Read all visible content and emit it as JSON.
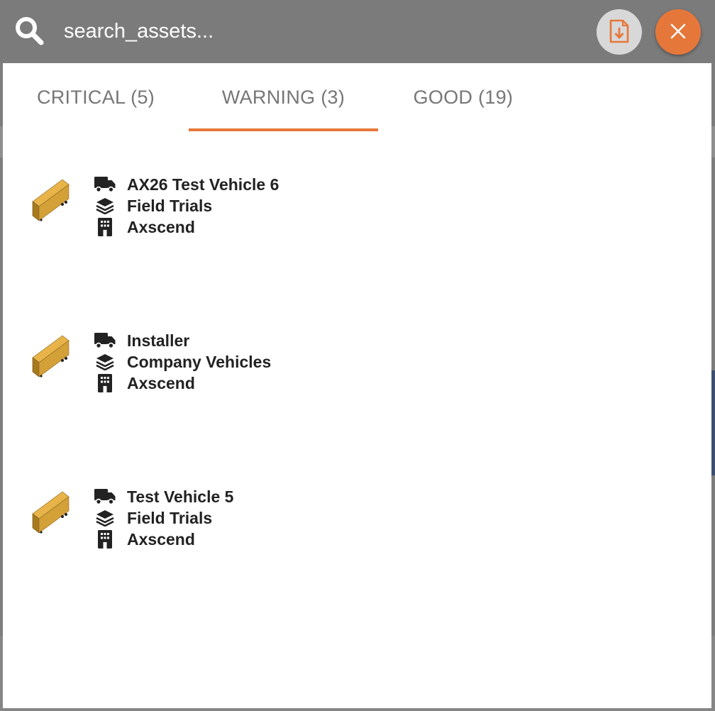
{
  "search": {
    "placeholder": "search_assets..."
  },
  "header": {
    "export_icon": "file-download-icon",
    "close_icon": "close-icon"
  },
  "tabs": [
    {
      "label": "CRITICAL (5)",
      "active": false
    },
    {
      "label": "WARNING (3)",
      "active": true
    },
    {
      "label": "GOOD (19)",
      "active": false
    }
  ],
  "assets": [
    {
      "vehicle": "AX26 Test Vehicle 6",
      "group": "Field Trials",
      "company": "Axscend"
    },
    {
      "vehicle": "Installer",
      "group": "Company Vehicles",
      "company": "Axscend"
    },
    {
      "vehicle": "Test Vehicle 5",
      "group": "Field Trials",
      "company": "Axscend"
    }
  ],
  "colors": {
    "accent": "#e6773a",
    "header_bg": "#7b7b7b",
    "tab_text": "#767676",
    "trailer": "#d9a23a"
  }
}
